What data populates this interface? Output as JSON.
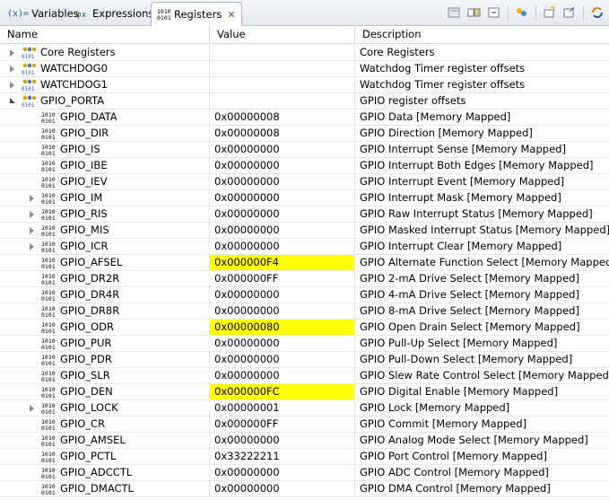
{
  "tabs": [
    {
      "label": "Variables",
      "active": false,
      "icon": "variables-icon"
    },
    {
      "label": "Expressions",
      "active": false,
      "icon": "expressions-icon"
    },
    {
      "label": "Registers",
      "active": true,
      "icon": "registers-icon"
    }
  ],
  "columns": {
    "name": "Name",
    "value": "Value",
    "description": "Description"
  },
  "colors": {
    "highlight": "#ffff00",
    "tab_active": "#ffffff"
  },
  "rows": [
    {
      "name": "Core Registers",
      "value": "",
      "description": "Core Registers",
      "level": 0,
      "type": "group",
      "expander": "collapsed",
      "changed": false
    },
    {
      "name": "WATCHDOG0",
      "value": "",
      "description": "Watchdog Timer register offsets",
      "level": 0,
      "type": "group",
      "expander": "collapsed",
      "changed": false
    },
    {
      "name": "WATCHDOG1",
      "value": "",
      "description": "Watchdog Timer register offsets",
      "level": 0,
      "type": "group",
      "expander": "collapsed",
      "changed": false
    },
    {
      "name": "GPIO_PORTA",
      "value": "",
      "description": "GPIO register offsets",
      "level": 0,
      "type": "group",
      "expander": "expanded",
      "changed": false
    },
    {
      "name": "GPIO_DATA",
      "value": "0x00000008",
      "description": "GPIO Data [Memory Mapped]",
      "level": 1,
      "type": "register",
      "expander": "none",
      "changed": false
    },
    {
      "name": "GPIO_DIR",
      "value": "0x00000008",
      "description": "GPIO Direction [Memory Mapped]",
      "level": 1,
      "type": "register",
      "expander": "none",
      "changed": false
    },
    {
      "name": "GPIO_IS",
      "value": "0x00000000",
      "description": "GPIO Interrupt Sense [Memory Mapped]",
      "level": 1,
      "type": "register",
      "expander": "none",
      "changed": false
    },
    {
      "name": "GPIO_IBE",
      "value": "0x00000000",
      "description": "GPIO Interrupt Both Edges [Memory Mapped]",
      "level": 1,
      "type": "register",
      "expander": "none",
      "changed": false
    },
    {
      "name": "GPIO_IEV",
      "value": "0x00000000",
      "description": "GPIO Interrupt Event [Memory Mapped]",
      "level": 1,
      "type": "register",
      "expander": "none",
      "changed": false
    },
    {
      "name": "GPIO_IM",
      "value": "0x00000000",
      "description": "GPIO Interrupt Mask [Memory Mapped]",
      "level": 1,
      "type": "register",
      "expander": "collapsed",
      "changed": false
    },
    {
      "name": "GPIO_RIS",
      "value": "0x00000000",
      "description": "GPIO Raw Interrupt Status [Memory Mapped]",
      "level": 1,
      "type": "register",
      "expander": "collapsed",
      "changed": false
    },
    {
      "name": "GPIO_MIS",
      "value": "0x00000000",
      "description": "GPIO Masked Interrupt Status [Memory Mapped]",
      "level": 1,
      "type": "register",
      "expander": "collapsed",
      "changed": false
    },
    {
      "name": "GPIO_ICR",
      "value": "0x00000000",
      "description": "GPIO Interrupt Clear [Memory Mapped]",
      "level": 1,
      "type": "register",
      "expander": "collapsed",
      "changed": false
    },
    {
      "name": "GPIO_AFSEL",
      "value": "0x000000F4",
      "description": "GPIO Alternate Function Select [Memory Mapped]",
      "level": 1,
      "type": "register",
      "expander": "none",
      "changed": true
    },
    {
      "name": "GPIO_DR2R",
      "value": "0x000000FF",
      "description": "GPIO 2-mA Drive Select [Memory Mapped]",
      "level": 1,
      "type": "register",
      "expander": "none",
      "changed": false
    },
    {
      "name": "GPIO_DR4R",
      "value": "0x00000000",
      "description": "GPIO 4-mA Drive Select [Memory Mapped]",
      "level": 1,
      "type": "register",
      "expander": "none",
      "changed": false
    },
    {
      "name": "GPIO_DR8R",
      "value": "0x00000000",
      "description": "GPIO 8-mA Drive Select [Memory Mapped]",
      "level": 1,
      "type": "register",
      "expander": "none",
      "changed": false
    },
    {
      "name": "GPIO_ODR",
      "value": "0x00000080",
      "description": "GPIO Open Drain Select [Memory Mapped]",
      "level": 1,
      "type": "register",
      "expander": "none",
      "changed": true
    },
    {
      "name": "GPIO_PUR",
      "value": "0x00000000",
      "description": "GPIO Pull-Up Select [Memory Mapped]",
      "level": 1,
      "type": "register",
      "expander": "none",
      "changed": false
    },
    {
      "name": "GPIO_PDR",
      "value": "0x00000000",
      "description": "GPIO Pull-Down Select [Memory Mapped]",
      "level": 1,
      "type": "register",
      "expander": "none",
      "changed": false
    },
    {
      "name": "GPIO_SLR",
      "value": "0x00000000",
      "description": "GPIO Slew Rate Control Select [Memory Mapped]",
      "level": 1,
      "type": "register",
      "expander": "none",
      "changed": false
    },
    {
      "name": "GPIO_DEN",
      "value": "0x000000FC",
      "description": "GPIO Digital Enable [Memory Mapped]",
      "level": 1,
      "type": "register",
      "expander": "none",
      "changed": true
    },
    {
      "name": "GPIO_LOCK",
      "value": "0x00000001",
      "description": "GPIO Lock [Memory Mapped]",
      "level": 1,
      "type": "register",
      "expander": "collapsed",
      "changed": false
    },
    {
      "name": "GPIO_CR",
      "value": "0x000000FF",
      "description": "GPIO Commit [Memory Mapped]",
      "level": 1,
      "type": "register",
      "expander": "none",
      "changed": false
    },
    {
      "name": "GPIO_AMSEL",
      "value": "0x00000000",
      "description": "GPIO Analog Mode Select [Memory Mapped]",
      "level": 1,
      "type": "register",
      "expander": "none",
      "changed": false
    },
    {
      "name": "GPIO_PCTL",
      "value": "0x33222211",
      "description": "GPIO Port Control [Memory Mapped]",
      "level": 1,
      "type": "register",
      "expander": "none",
      "changed": false
    },
    {
      "name": "GPIO_ADCCTL",
      "value": "0x00000000",
      "description": "GPIO ADC Control [Memory Mapped]",
      "level": 1,
      "type": "register",
      "expander": "none",
      "changed": false
    },
    {
      "name": "GPIO_DMACTL",
      "value": "0x00000000",
      "description": "GPIO DMA Control [Memory Mapped]",
      "level": 1,
      "type": "register",
      "expander": "none",
      "changed": false
    }
  ]
}
